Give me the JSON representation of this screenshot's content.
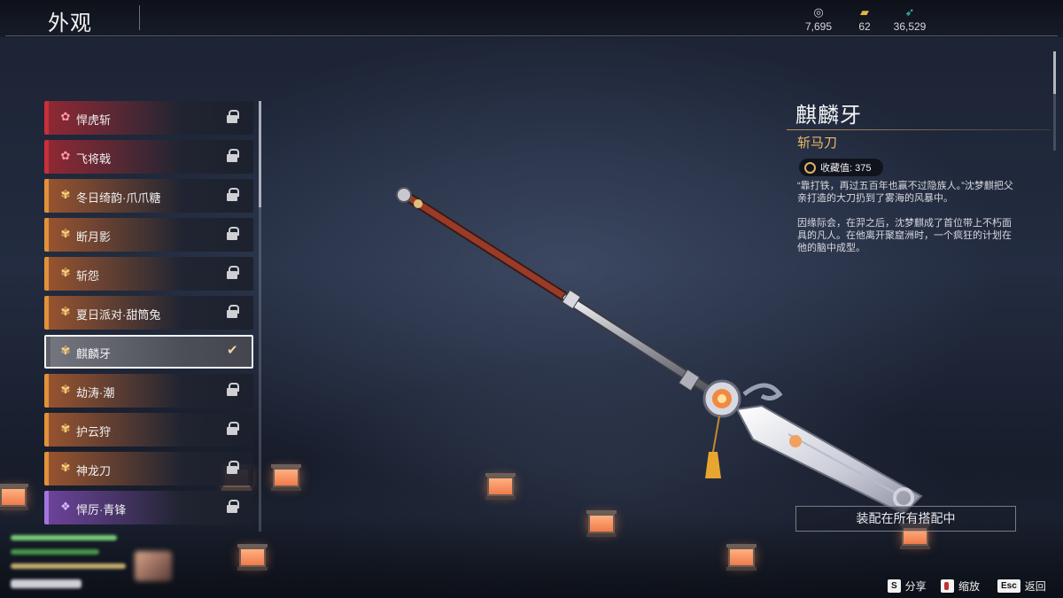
{
  "header": {
    "title": "外观",
    "currencies": [
      {
        "icon": "silver-coin-icon",
        "value": "7,695"
      },
      {
        "icon": "gold-ticket-icon",
        "value": "62"
      },
      {
        "icon": "jade-feather-icon",
        "value": "36,529"
      }
    ]
  },
  "skins": [
    {
      "label": "悍虎斩",
      "rarity": "red",
      "icon": "flower-icon",
      "state": "locked"
    },
    {
      "label": "飞将戟",
      "rarity": "red",
      "icon": "flower-icon",
      "state": "locked"
    },
    {
      "label": "冬日绮韵·爪爪糖",
      "rarity": "orange",
      "icon": "flower-icon",
      "state": "locked"
    },
    {
      "label": "断月影",
      "rarity": "orange",
      "icon": "flower-icon",
      "state": "locked"
    },
    {
      "label": "斩怨",
      "rarity": "orange",
      "icon": "flower-icon",
      "state": "locked"
    },
    {
      "label": "夏日派对·甜筒兔",
      "rarity": "orange",
      "icon": "flower-icon",
      "state": "locked"
    },
    {
      "label": "麒麟牙",
      "rarity": "orange",
      "icon": "flower-icon",
      "state": "selected"
    },
    {
      "label": "劫涛·潮",
      "rarity": "orange",
      "icon": "flower-icon",
      "state": "locked"
    },
    {
      "label": "护云狩",
      "rarity": "orange",
      "icon": "flower-icon",
      "state": "locked"
    },
    {
      "label": "神龙刀",
      "rarity": "orange",
      "icon": "flower-icon",
      "state": "locked"
    },
    {
      "label": "悍厉·青锋",
      "rarity": "purple",
      "icon": "flower-icon",
      "state": "locked"
    }
  ],
  "detail": {
    "name": "麒麟牙",
    "type": "斩马刀",
    "collection_label": "收藏值: 375",
    "description": [
      "“靠打铁，再过五百年也赢不过隐族人。”沈梦麒把父亲打造的大刀扔到了雾海的风暴中。",
      "因缘际会，在羿之后，沈梦麒成了首位带上不朽面具的凡人。在他离开聚窟洲时，一个疯狂的计划在他的脑中成型。"
    ],
    "equip_button": "装配在所有搭配中"
  },
  "hints": [
    {
      "key": "S",
      "label": "分享"
    },
    {
      "key": "",
      "icon": "mouse-icon",
      "label": "缩放"
    },
    {
      "key": "Esc",
      "label": "返回"
    }
  ],
  "colors": {
    "red": "#c8303a",
    "orange": "#e2913b",
    "purple": "#a275e0",
    "accent_gold": "#e9b96a"
  }
}
